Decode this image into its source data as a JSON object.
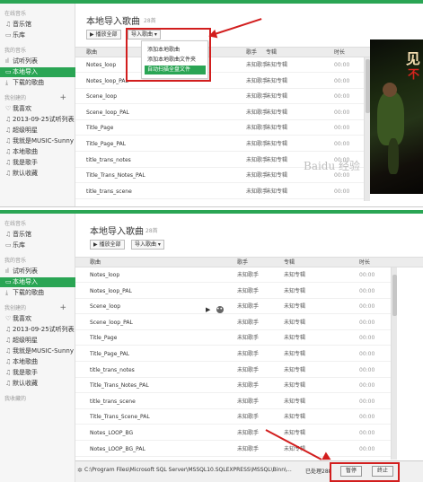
{
  "top": {
    "sidebar": [
      {
        "kind": "head",
        "label": "在线音乐"
      },
      {
        "kind": "item",
        "label": "音乐馆",
        "icon": "music-note-icon",
        "glyph": "♫"
      },
      {
        "kind": "item",
        "label": "乐库",
        "icon": "library-icon",
        "glyph": "▭"
      },
      {
        "kind": "head",
        "label": "我的音乐"
      },
      {
        "kind": "item",
        "label": "试听列表",
        "icon": "bars-icon",
        "glyph": "ıl"
      },
      {
        "kind": "item",
        "label": "本地导入",
        "icon": "monitor-icon",
        "glyph": "▭",
        "selected": true
      },
      {
        "kind": "item",
        "label": "下载的歌曲",
        "icon": "download-icon",
        "glyph": "⤓"
      },
      {
        "kind": "head",
        "label": "我创建的",
        "plus": "+"
      },
      {
        "kind": "item",
        "label": "我喜欢",
        "icon": "heart-icon",
        "glyph": "♡"
      },
      {
        "kind": "item",
        "label": "2013-09-25试听列表",
        "icon": "playlist-icon",
        "glyph": "♫"
      },
      {
        "kind": "item",
        "label": "超级明星",
        "icon": "playlist-icon",
        "glyph": "♫"
      },
      {
        "kind": "item",
        "label": "我就是MUSIC-Sunny",
        "icon": "playlist-icon",
        "glyph": "♫"
      },
      {
        "kind": "item",
        "label": "本地歌曲",
        "icon": "playlist-icon",
        "glyph": "♫"
      },
      {
        "kind": "item",
        "label": "我是歌手",
        "icon": "playlist-icon",
        "glyph": "♫"
      },
      {
        "kind": "item",
        "label": "默认收藏",
        "icon": "playlist-icon",
        "glyph": "♫"
      }
    ],
    "title": "本地导入歌曲",
    "count": "28首",
    "play_all": "▶ 播放全部",
    "import": "导入歌曲 ▾",
    "columns": {
      "song": "歌曲",
      "artist": "歌手",
      "album": "专辑",
      "length": "时长"
    },
    "menu": [
      "添加本地歌曲",
      "添加本地歌曲文件夹",
      "自动扫描全盘文件"
    ],
    "rows": [
      {
        "song": "Notes_loop",
        "artist": "未知歌手",
        "album": "未知专辑",
        "length": "00:00"
      },
      {
        "song": "Notes_loop_PAL",
        "artist": "未知歌手",
        "album": "未知专辑",
        "length": "00:00"
      },
      {
        "song": "Scene_loop",
        "artist": "未知歌手",
        "album": "未知专辑",
        "length": "00:00"
      },
      {
        "song": "Scene_loop_PAL",
        "artist": "未知歌手",
        "album": "未知专辑",
        "length": "00:00"
      },
      {
        "song": "Title_Page",
        "artist": "未知歌手",
        "album": "未知专辑",
        "length": "00:00"
      },
      {
        "song": "Title_Page_PAL",
        "artist": "未知歌手",
        "album": "未知专辑",
        "length": "00:00"
      },
      {
        "song": "title_trans_notes",
        "artist": "未知歌手",
        "album": "未知专辑",
        "length": "00:00"
      },
      {
        "song": "Title_Trans_Notes_PAL",
        "artist": "未知歌手",
        "album": "未知专辑",
        "length": "00:00"
      },
      {
        "song": "title_trans_scene",
        "artist": "未知歌手",
        "album": "未知专辑",
        "length": "00:00"
      }
    ],
    "art_text": "见",
    "art_red": "不",
    "watermark": "Baidu 经验"
  },
  "bottom": {
    "sidebar": [
      {
        "kind": "head",
        "label": "在线音乐"
      },
      {
        "kind": "item",
        "label": "音乐馆",
        "icon": "music-note-icon",
        "glyph": "♫"
      },
      {
        "kind": "item",
        "label": "乐库",
        "icon": "library-icon",
        "glyph": "▭"
      },
      {
        "kind": "head",
        "label": "我的音乐"
      },
      {
        "kind": "item",
        "label": "试听列表",
        "icon": "bars-icon",
        "glyph": "ıl"
      },
      {
        "kind": "item",
        "label": "本地导入",
        "icon": "monitor-icon",
        "glyph": "▭",
        "selected": true
      },
      {
        "kind": "item",
        "label": "下载的歌曲",
        "icon": "download-icon",
        "glyph": "⤓"
      },
      {
        "kind": "head",
        "label": "我创建的",
        "plus": "+"
      },
      {
        "kind": "item",
        "label": "我喜欢",
        "icon": "heart-icon",
        "glyph": "♡"
      },
      {
        "kind": "item",
        "label": "2013-09-25试听列表",
        "icon": "playlist-icon",
        "glyph": "♫"
      },
      {
        "kind": "item",
        "label": "超级明星",
        "icon": "playlist-icon",
        "glyph": "♫"
      },
      {
        "kind": "item",
        "label": "我就是MUSIC-Sunny",
        "icon": "playlist-icon",
        "glyph": "♫"
      },
      {
        "kind": "item",
        "label": "本地歌曲",
        "icon": "playlist-icon",
        "glyph": "♫"
      },
      {
        "kind": "item",
        "label": "我是歌手",
        "icon": "playlist-icon",
        "glyph": "♫"
      },
      {
        "kind": "item",
        "label": "默认收藏",
        "icon": "playlist-icon",
        "glyph": "♫"
      },
      {
        "kind": "head",
        "label": "我收藏的"
      }
    ],
    "title": "本地导入歌曲",
    "count": "28首",
    "play_all": "▶ 播放全部",
    "import": "导入歌曲 ▾",
    "columns": {
      "song": "歌曲",
      "artist": "歌手",
      "album": "专辑",
      "length": "时长"
    },
    "rows": [
      {
        "song": "Notes_loop",
        "artist": "未知歌手",
        "album": "未知专辑",
        "length": "00:00"
      },
      {
        "song": "Notes_loop_PAL",
        "artist": "未知歌手",
        "album": "未知专辑",
        "length": "00:00"
      },
      {
        "song": "Scene_loop",
        "artist": "未知歌手",
        "album": "未知专辑",
        "length": "00:00"
      },
      {
        "song": "Scene_loop_PAL",
        "artist": "未知歌手",
        "album": "未知专辑",
        "length": "00:00"
      },
      {
        "song": "Title_Page",
        "artist": "未知歌手",
        "album": "未知专辑",
        "length": "00:00"
      },
      {
        "song": "Title_Page_PAL",
        "artist": "未知歌手",
        "album": "未知专辑",
        "length": "00:00"
      },
      {
        "song": "title_trans_notes",
        "artist": "未知歌手",
        "album": "未知专辑",
        "length": "00:00"
      },
      {
        "song": "Title_Trans_Notes_PAL",
        "artist": "未知歌手",
        "album": "未知专辑",
        "length": "00:00"
      },
      {
        "song": "title_trans_scene",
        "artist": "未知歌手",
        "album": "未知专辑",
        "length": "00:00"
      },
      {
        "song": "Title_Trans_Scene_PAL",
        "artist": "未知歌手",
        "album": "未知专辑",
        "length": "00:00"
      },
      {
        "song": "Notes_LOOP_BG",
        "artist": "未知歌手",
        "album": "未知专辑",
        "length": "00:00"
      },
      {
        "song": "Notes_LOOP_BG_PAL",
        "artist": "未知歌手",
        "album": "未知专辑",
        "length": "00:00"
      }
    ],
    "status_path": "C:\\Program Files\\Microsoft SQL Server\\MSSQL10.SQLEXPRESS\\MSSQL\\Binn\\...",
    "status_count": "已处理288",
    "skip": "暂停",
    "stop": "终止"
  },
  "colors": {
    "accent": "#2aa554",
    "annotation": "#d21e1e"
  }
}
